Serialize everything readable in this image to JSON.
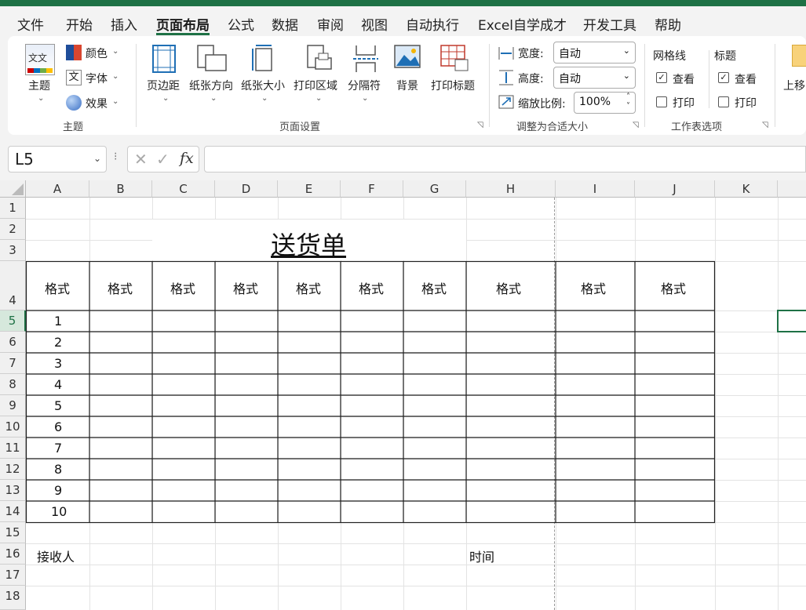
{
  "menu": {
    "tabs": [
      "文件",
      "开始",
      "插入",
      "页面布局",
      "公式",
      "数据",
      "审阅",
      "视图",
      "自动执行",
      "Excel自学成才",
      "开发工具",
      "帮助"
    ],
    "active_tab": "页面布局"
  },
  "ribbon": {
    "theme_group": {
      "theme_label": "主题",
      "colors_label": "颜色",
      "fonts_label": "字体",
      "effects_label": "效果",
      "theme_icon_text": "文文",
      "fonts_icon_text": "文",
      "group_label": "主题"
    },
    "page_setup": {
      "margins_label": "页边距",
      "orientation_label": "纸张方向",
      "size_label": "纸张大小",
      "print_area_label": "打印区域",
      "breaks_label": "分隔符",
      "background_label": "背景",
      "print_titles_label": "打印标题",
      "group_label": "页面设置"
    },
    "scale": {
      "width_label": "宽度:",
      "width_value": "自动",
      "height_label": "高度:",
      "height_value": "自动",
      "scale_label": "缩放比例:",
      "scale_value": "100%",
      "group_label": "调整为合适大小"
    },
    "sheet_options": {
      "gridlines_label": "网格线",
      "headings_label": "标题",
      "view_label": "查看",
      "print_label": "打印",
      "gridlines_view_checked": true,
      "gridlines_print_checked": false,
      "headings_view_checked": true,
      "headings_print_checked": false,
      "group_label": "工作表选项"
    },
    "arrange": {
      "bring_forward_label": "上移"
    }
  },
  "formula_bar": {
    "name_box": "L5",
    "fx_symbol": "fx",
    "formula": ""
  },
  "sheet": {
    "column_headers": [
      "A",
      "B",
      "C",
      "D",
      "E",
      "F",
      "G",
      "H",
      "I",
      "J",
      "K"
    ],
    "row_headers": [
      "1",
      "2",
      "3",
      "4",
      "5",
      "6",
      "7",
      "8",
      "9",
      "10",
      "11",
      "12",
      "13",
      "14",
      "15",
      "16",
      "17",
      "18"
    ],
    "title": "送货单",
    "table_headers": [
      "格式",
      "格式",
      "格式",
      "格式",
      "格式",
      "格式",
      "格式",
      "格式",
      "格式",
      "格式"
    ],
    "row_numbers": [
      "1",
      "2",
      "3",
      "4",
      "5",
      "6",
      "7",
      "8",
      "9",
      "10"
    ],
    "receiver_label": "接收人",
    "time_label": "时间"
  },
  "colors": {
    "accent": "#1e7145",
    "selection": "#1e7145"
  }
}
